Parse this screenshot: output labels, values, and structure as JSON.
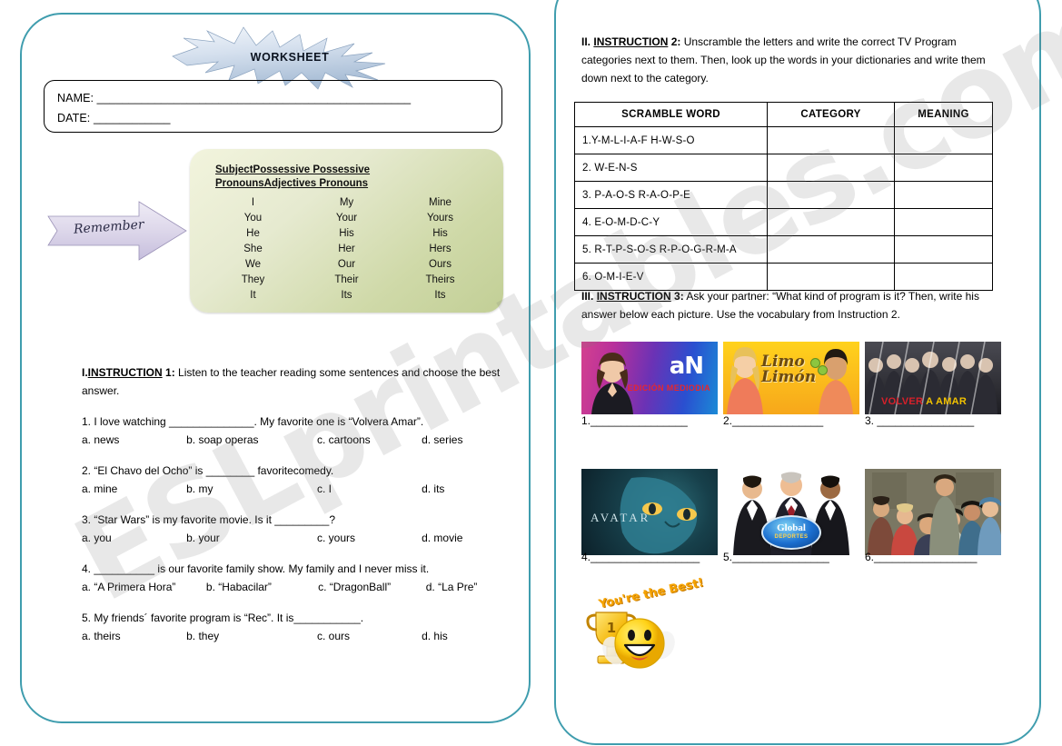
{
  "document": {
    "type": "esl-worksheet",
    "title": "WORKSHEET",
    "watermark": "ESLprintables.com",
    "border_color": "#3f9dae"
  },
  "left_page": {
    "name_field": "NAME: _________________________________________________",
    "date_field": "DATE: ____________",
    "remember_arrow": {
      "label": "Remember",
      "color": "#d8d3e8"
    },
    "pronoun_box": {
      "header_line1": "SubjectPossessive Possessive",
      "header_line2": "PronounsAdjectives Pronouns",
      "columns": [
        "Subject Pronouns",
        "Possessive Adjectives",
        "Possessive Pronouns"
      ],
      "rows": [
        [
          "I",
          "My",
          "Mine"
        ],
        [
          "You",
          "Your",
          "Yours"
        ],
        [
          "He",
          "His",
          "His"
        ],
        [
          "She",
          "Her",
          "Hers"
        ],
        [
          "We",
          "Our",
          "Ours"
        ],
        [
          "They",
          "Their",
          "Theirs"
        ],
        [
          "It",
          "Its",
          "Its"
        ]
      ]
    },
    "instruction1": {
      "number": "I.",
      "label": "INSTRUCTION",
      "index": "1:",
      "text": "Listen to the teacher reading some sentences and choose the best answer.",
      "questions": [
        {
          "text": "1. I love watching ______________. My favorite one is “Volvera Amar”.",
          "options": [
            "a. news",
            "b. soap operas",
            "c. cartoons",
            "d. series"
          ]
        },
        {
          "text": "2. “El Chavo del Ocho” is ________ favoritecomedy.",
          "options": [
            "a. mine",
            "b. my",
            "c. I",
            "d. its"
          ]
        },
        {
          "text": "3. “Star Wars” is my favorite movie. Is it _________?",
          "options": [
            "a. you",
            "b. your",
            "c. yours",
            "d. movie"
          ]
        },
        {
          "text": "4. __________ is our favorite family show. My family and I never miss it.",
          "options": [
            "a. “A Primera Hora”",
            "b. “Habacilar”",
            "c. “DragonBall”",
            "d. “La Pre”"
          ]
        },
        {
          "text": "5. My friends´ favorite program is “Rec”. It is___________.",
          "options": [
            "a. theirs",
            "b. they",
            "c. ours",
            "d. his"
          ]
        }
      ]
    }
  },
  "right_page": {
    "instruction2": {
      "number": "II.",
      "label": "INSTRUCTION",
      "index": "2:",
      "text": "Unscramble the letters and write the correct TV Program categories next to them. Then, look up the words in your dictionaries and write them down next to the category."
    },
    "scramble_table": {
      "headers": [
        "SCRAMBLE WORD",
        "CATEGORY",
        "MEANING"
      ],
      "rows": [
        {
          "word": "1.Y-M-L-I-A-F  H-W-S-O",
          "category": "",
          "meaning": ""
        },
        {
          "word": "2. W-E-N-S",
          "category": "",
          "meaning": ""
        },
        {
          "word": " 3. P-A-O-S  R-A-O-P-E",
          "category": "",
          "meaning": ""
        },
        {
          "word": " 4. E-O-M-D-C-Y",
          "category": "",
          "meaning": ""
        },
        {
          "word": " 5. R-T-P-S-O-S  R-P-O-G-R-M-A",
          "category": "",
          "meaning": ""
        },
        {
          "word": "6. O-M-I-E-V",
          "category": "",
          "meaning": ""
        }
      ]
    },
    "instruction3": {
      "number": "III.",
      "label": "INSTRUCTION",
      "index": "3:",
      "text": "Ask your partner: “What kind of program is it?  Then, write his answer below each picture. Use the vocabulary from Instruction 2."
    },
    "pictures_row1": [
      {
        "name": "news-program",
        "logo": "aN",
        "caption": "EDICIÓN MEDIODIA"
      },
      {
        "name": "limon-comedy",
        "logo": "Limo",
        "caption": "Limón"
      },
      {
        "name": "volver-a-amar-soap",
        "logo": "VOLVER",
        "caption": "A AMAR"
      }
    ],
    "pictures_row2": [
      {
        "name": "avatar-movie",
        "logo": "AVATAR",
        "caption": ""
      },
      {
        "name": "global-deportes-sports",
        "logo": "Global",
        "caption": "DEPORTES"
      },
      {
        "name": "chavo-del-ocho-comedy",
        "logo": "",
        "caption": ""
      }
    ],
    "answer_lines_row1": [
      "1.________________",
      "2._______________",
      "3. ________________"
    ],
    "answer_lines_row2": [
      "4.__________________",
      "5.________________",
      "6._________________"
    ],
    "sticker": {
      "text": "You're the Best!",
      "trophy_number": "1"
    }
  }
}
